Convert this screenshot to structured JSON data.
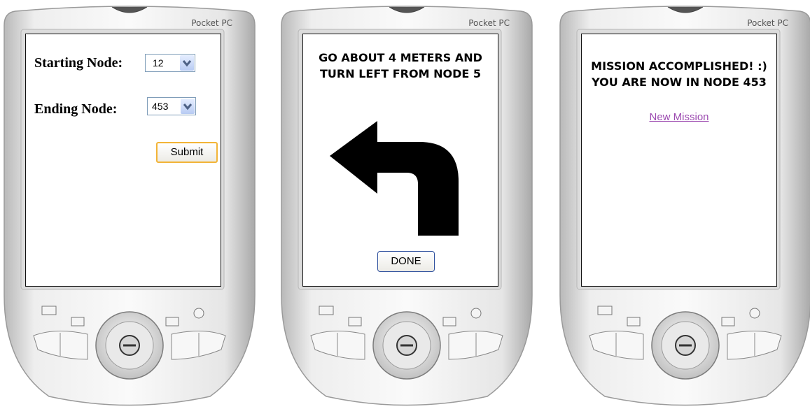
{
  "devices": [
    {
      "brand": "Pocket PC"
    },
    {
      "brand": "Pocket PC"
    },
    {
      "brand": "Pocket PC"
    }
  ],
  "route_form": {
    "starting_label": "Starting Node:",
    "starting_value": "12",
    "ending_label": "Ending Node:",
    "ending_value": "453",
    "submit_label": "Submit"
  },
  "direction": {
    "instruction": "GO ABOUT 4 METERS AND TURN LEFT FROM NODE 5",
    "arrow_icon": "turn-left-arrow-icon",
    "done_label": "DONE"
  },
  "result": {
    "message": "MISSION ACCOMPLISHED! :) YOU ARE NOW IN NODE 453",
    "new_mission_label": "New Mission"
  },
  "colors": {
    "link": "#9c4ab0",
    "submit_border": "#f2b437",
    "done_border": "#2d4f9d"
  }
}
